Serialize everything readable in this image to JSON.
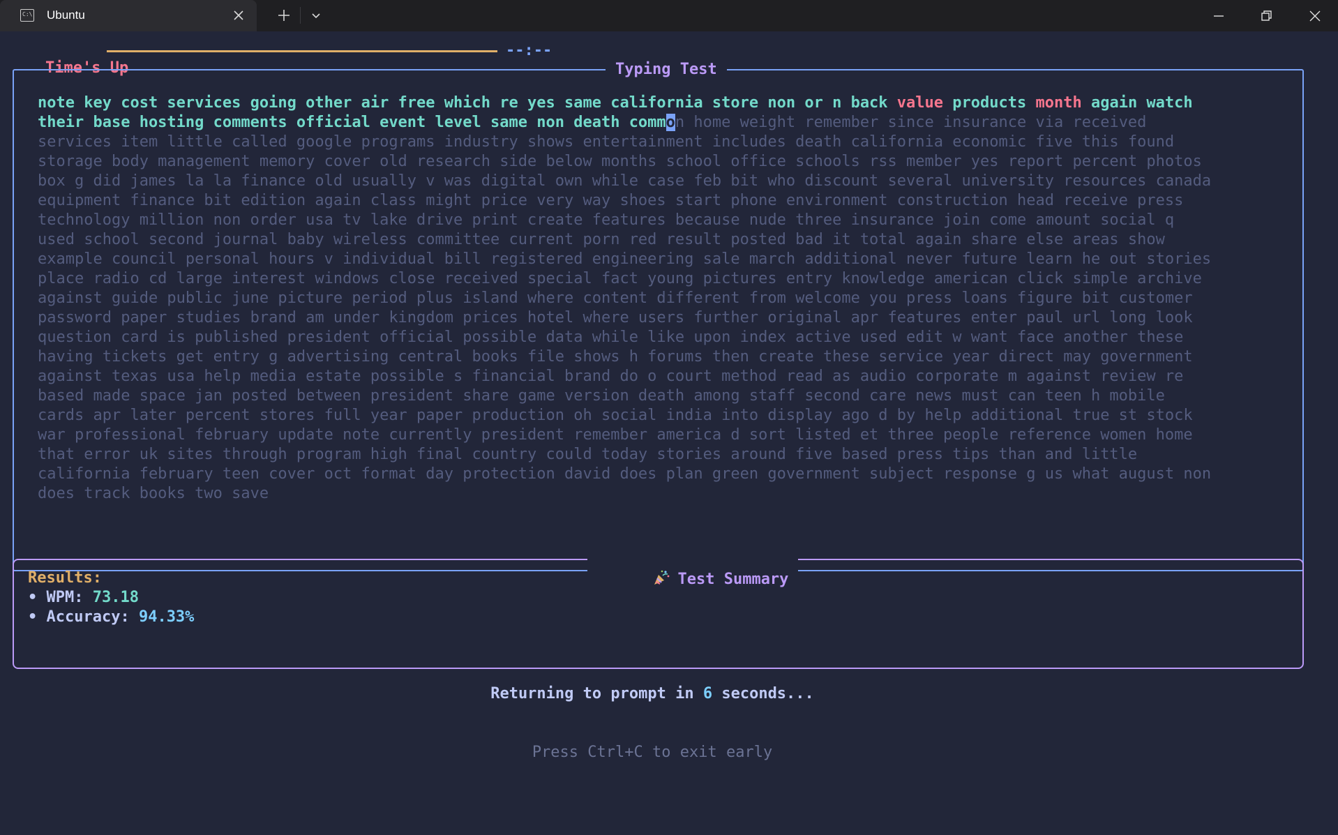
{
  "window": {
    "tab_title": "Ubuntu",
    "tab_icon": "terminal-icon",
    "close_tab_icon": "close-icon",
    "new_tab_icon": "plus-icon",
    "dropdown_icon": "chevron-down-icon",
    "minimize_icon": "minimize-icon",
    "maximize_icon": "restore-icon",
    "close_icon": "close-icon"
  },
  "timer": {
    "label": "Time's Up",
    "time": "--:--",
    "progress": 0,
    "bar_color": "#e0af68"
  },
  "typing_test": {
    "title": "Typing Test",
    "lines": [
      [
        {
          "t": "note key cost services going other air free which re yes same california store non or n back ",
          "s": "ok"
        },
        {
          "t": "value",
          "s": "bad"
        },
        {
          "t": " products ",
          "s": "ok"
        },
        {
          "t": "month",
          "s": "bad"
        },
        {
          "t": " again watch",
          "s": "ok"
        }
      ],
      [
        {
          "t": "their base hosting comments official event level same non death comm",
          "s": "ok"
        },
        {
          "t": "o",
          "s": "cursor"
        },
        {
          "t": "n home weight remember since insurance via received",
          "s": "rest"
        }
      ],
      [
        {
          "t": "services item little called google programs industry shows entertainment includes death california economic five this found",
          "s": "rest"
        }
      ],
      [
        {
          "t": "storage body management memory cover old research side below months school office schools rss member yes report percent photos",
          "s": "rest"
        }
      ],
      [
        {
          "t": "box g did james la la finance old usually v was digital own while case feb bit who discount several university resources canada",
          "s": "rest"
        }
      ],
      [
        {
          "t": "equipment finance bit edition again class might price very way shoes start phone environment construction head receive press",
          "s": "rest"
        }
      ],
      [
        {
          "t": "technology million non order usa tv lake drive print create features because nude three insurance join come amount social q",
          "s": "rest"
        }
      ],
      [
        {
          "t": "used school second journal baby wireless committee current porn red result posted bad it total again share else areas show",
          "s": "rest"
        }
      ],
      [
        {
          "t": "example council personal hours v individual bill registered engineering sale march additional never future learn he out stories",
          "s": "rest"
        }
      ],
      [
        {
          "t": "place radio cd large interest windows close received special fact young pictures entry knowledge american click simple archive",
          "s": "rest"
        }
      ],
      [
        {
          "t": "against guide public june picture period plus island where content different from welcome you press loans figure bit customer",
          "s": "rest"
        }
      ],
      [
        {
          "t": "password paper studies brand am under kingdom prices hotel where users further original apr features enter paul url long look",
          "s": "rest"
        }
      ],
      [
        {
          "t": "question card is published president official possible data while like upon index active used edit w want face another these",
          "s": "rest"
        }
      ],
      [
        {
          "t": "having tickets get entry g advertising central books file shows h forums then create these service year direct may government",
          "s": "rest"
        }
      ],
      [
        {
          "t": "against texas usa help media estate possible s financial brand do o court method read as audio corporate m against review re",
          "s": "rest"
        }
      ],
      [
        {
          "t": "based made space jan posted between president share game version death among staff second care news must can teen h mobile",
          "s": "rest"
        }
      ],
      [
        {
          "t": "cards apr later percent stores full year paper production oh social india into display ago d by help additional true st stock",
          "s": "rest"
        }
      ],
      [
        {
          "t": "war professional february update note currently president remember america d sort listed et three people reference women home",
          "s": "rest"
        }
      ],
      [
        {
          "t": "that error uk sites through program high final country could today stories around five based press tips than and little",
          "s": "rest"
        }
      ],
      [
        {
          "t": "california february teen cover oct format day protection david does plan green government subject response g us what august non",
          "s": "rest"
        }
      ],
      [
        {
          "t": "does track books two save",
          "s": "rest"
        }
      ]
    ]
  },
  "summary": {
    "title": "Test Summary",
    "icon": "party-popper-icon",
    "results_label": "Results:",
    "wpm_label": "• WPM: ",
    "wpm_value": "73.18",
    "accuracy_label": "• Accuracy: ",
    "accuracy_value": "94.33%"
  },
  "footer": {
    "returning_prefix": "Returning to prompt in ",
    "seconds": "6",
    "returning_suffix": " seconds...",
    "hint": "Press Ctrl+C to exit early"
  },
  "colors": {
    "background": "#222639",
    "correct": "#73daca",
    "incorrect": "#f7768e",
    "untyped": "#545c7e",
    "cursor": "#7aa2f7",
    "panel_border": "#7aa2f7",
    "summary_border": "#bb9af7",
    "accent_title": "#bb9af7"
  }
}
